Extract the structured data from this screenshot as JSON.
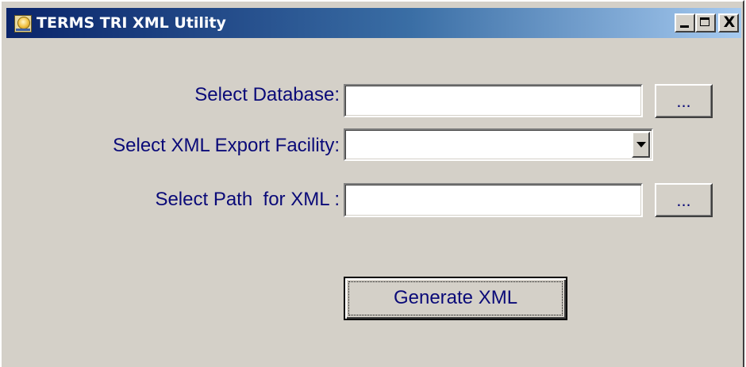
{
  "window": {
    "title": "TERMS TRI XML Utility",
    "icon": "app-sun-icon",
    "controls": {
      "minimize": "minimize-icon",
      "maximize": "maximize-icon",
      "close": "close-icon",
      "close_glyph": "X"
    }
  },
  "form": {
    "database": {
      "label": "Select Database:",
      "value": "",
      "browse_label": "..."
    },
    "facility": {
      "label": "Select XML Export Facility:",
      "selected": ""
    },
    "path": {
      "label": "Select Path  for XML :",
      "value": "",
      "browse_label": "..."
    },
    "generate_label": "Generate XML"
  },
  "colors": {
    "title_bar_start": "#0a246a",
    "title_bar_end": "#a6caf0",
    "label_text": "#0a0a78",
    "window_face": "#d4d0c8"
  }
}
